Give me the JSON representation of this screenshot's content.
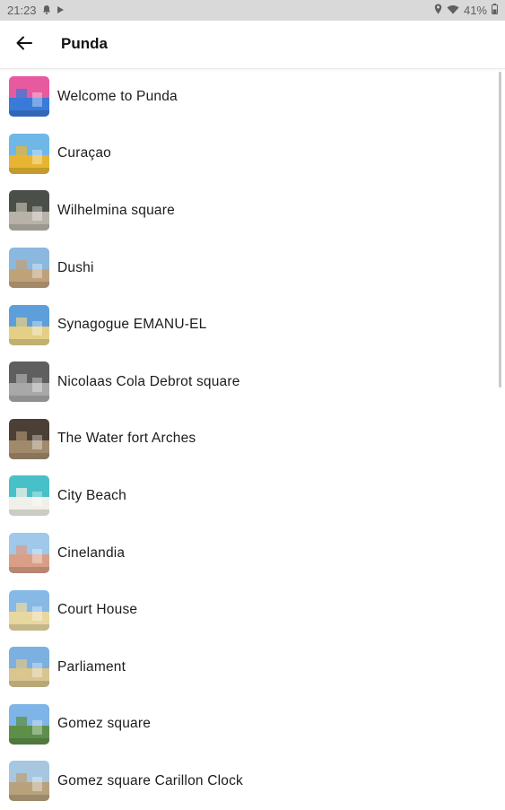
{
  "status_bar": {
    "time": "21:23",
    "battery": "41%",
    "icons": [
      "notification-bell-icon",
      "play-icon",
      "location-icon",
      "wifi-icon",
      "battery-icon"
    ]
  },
  "app_bar": {
    "title": "Punda",
    "back_icon": "arrow-back-icon"
  },
  "list": {
    "items": [
      {
        "label": "Welcome to Punda",
        "thumb_colors": [
          "#e85aa0",
          "#3a7ad9"
        ]
      },
      {
        "label": "Curaçao",
        "thumb_colors": [
          "#6fb7e6",
          "#e7b531"
        ]
      },
      {
        "label": "Wilhelmina square",
        "thumb_colors": [
          "#4a4f4a",
          "#b8b3a8"
        ]
      },
      {
        "label": "Dushi",
        "thumb_colors": [
          "#8bb8de",
          "#c0a27a"
        ]
      },
      {
        "label": "Synagogue EMANU-EL",
        "thumb_colors": [
          "#5d9fdb",
          "#e4cf86"
        ]
      },
      {
        "label": "Nicolaas Cola Debrot square",
        "thumb_colors": [
          "#5f5f5f",
          "#a8a8a8"
        ]
      },
      {
        "label": "The Water fort Arches",
        "thumb_colors": [
          "#4a4035",
          "#a18a6c"
        ]
      },
      {
        "label": "City Beach",
        "thumb_colors": [
          "#48c0c7",
          "#f0f0e8"
        ]
      },
      {
        "label": "Cinelandia",
        "thumb_colors": [
          "#9fc8ea",
          "#d99f86"
        ]
      },
      {
        "label": "Court House",
        "thumb_colors": [
          "#86b9e6",
          "#e8d8a0"
        ]
      },
      {
        "label": "Parliament",
        "thumb_colors": [
          "#7cb0e0",
          "#d9c58e"
        ]
      },
      {
        "label": "Gomez square",
        "thumb_colors": [
          "#7fb4e8",
          "#5d8f4a"
        ]
      },
      {
        "label": "Gomez square Carillon Clock",
        "thumb_colors": [
          "#a7c6e0",
          "#b8a27c"
        ]
      }
    ]
  }
}
